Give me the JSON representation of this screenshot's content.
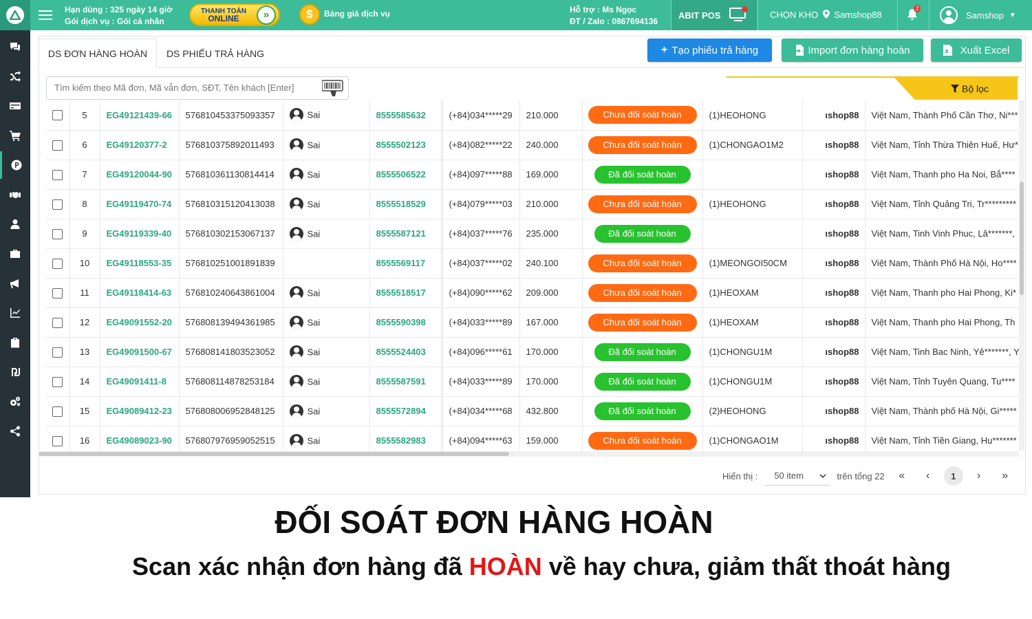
{
  "header": {
    "subscription_remaining": "Hạn dùng : 325 ngày 14 giờ",
    "subscription_plan": "Gói dịch vụ : Gói cá nhân",
    "pay_online_line1": "THANH TOÁN",
    "pay_online_line2": "ONLINE",
    "price_list_link": "Bảng giá dịch vụ",
    "support_contact": "Hỗ trợ : Ms Ngọc",
    "support_phone": "ĐT / Zalo : 0867694136",
    "abit_pos_label": "ABIT POS",
    "warehouse_label": "CHỌN KHO",
    "warehouse_name": "Samshop88",
    "notification_count": "2",
    "user_name": "Samshop"
  },
  "sidebar": {
    "items": [
      {
        "icon": "chat-icon"
      },
      {
        "icon": "shuffle-icon"
      },
      {
        "icon": "card-icon"
      },
      {
        "icon": "cart-icon"
      },
      {
        "icon": "p-icon",
        "active": true
      },
      {
        "icon": "handshake-icon"
      },
      {
        "icon": "user-icon"
      },
      {
        "icon": "briefcase-icon"
      },
      {
        "icon": "megaphone-icon"
      },
      {
        "icon": "chart-icon"
      },
      {
        "icon": "clipboard-icon"
      },
      {
        "icon": "currency-icon"
      },
      {
        "icon": "cogs-icon"
      },
      {
        "icon": "share-icon"
      }
    ]
  },
  "tabs": [
    {
      "label": "DS ĐƠN HÀNG HOÀN",
      "active": true
    },
    {
      "label": "DS PHIẾU TRẢ HÀNG",
      "active": false
    }
  ],
  "actions": {
    "create_return": "Tạo phiếu trả hàng",
    "import_returns": "Import đơn hàng hoàn",
    "export_excel": "Xuất Excel"
  },
  "search": {
    "placeholder": "Tìm kiếm theo Mã đơn, Mã vẫn đơn, SĐT, Tên khách [Enter]",
    "value": ""
  },
  "filter_label": "Bộ lọc",
  "colors": {
    "brand_green": "#3cbc98",
    "link_green": "#2da77e",
    "status_pending": "#ff6a13",
    "status_done": "#27c22e",
    "filter_yellow": "#f5c518",
    "create_blue": "#1e88e5"
  },
  "rows": [
    {
      "stt": "5",
      "code": "EG49121439-66",
      "tracking": "576810453375093357",
      "user": "Sai",
      "bill": "8555585632",
      "phone": "(+84)034*****29",
      "amount": "210.000",
      "status": "Chưa đối soát hoàn",
      "status_type": "pending",
      "item": "(1)HEOHONG",
      "shop": "ıshop88",
      "address": "Việt Nam, Thành Phố Cần Thơ, Ni***"
    },
    {
      "stt": "6",
      "code": "EG49120377-2",
      "tracking": "576810375892011493",
      "user": "Sai",
      "bill": "8555502123",
      "phone": "(+84)082*****22",
      "amount": "240.000",
      "status": "Chưa đối soát hoàn",
      "status_type": "pending",
      "item": "(1)CHONGAO1M2",
      "shop": "ıshop88",
      "address": "Việt Nam, Tỉnh Thừa Thiên Huế, Hư*"
    },
    {
      "stt": "7",
      "code": "EG49120044-90",
      "tracking": "576810361130814414",
      "user": "Sai",
      "bill": "8555506522",
      "phone": "(+84)097*****88",
      "amount": "169.000",
      "status": "Đã đối soát hoàn",
      "status_type": "done",
      "item": "",
      "shop": "ıshop88",
      "address": "Việt Nam, Thanh pho Ha Noi, Bắ****"
    },
    {
      "stt": "8",
      "code": "EG49119470-74",
      "tracking": "576810315120413038",
      "user": "Sai",
      "bill": "8555518529",
      "phone": "(+84)079*****03",
      "amount": "210.000",
      "status": "Chưa đối soát hoàn",
      "status_type": "pending",
      "item": "(1)HEOHONG",
      "shop": "ıshop88",
      "address": "Việt Nam, Tỉnh Quảng Tri, Tr*********"
    },
    {
      "stt": "9",
      "code": "EG49119339-40",
      "tracking": "576810302153067137",
      "user": "Sai",
      "bill": "8555587121",
      "phone": "(+84)037*****76",
      "amount": "235.000",
      "status": "Đã đối soát hoàn",
      "status_type": "done",
      "item": "",
      "shop": "ıshop88",
      "address": "Việt Nam, Tinh Vinh Phuc, Lâ*******,"
    },
    {
      "stt": "10",
      "code": "EG49118553-35",
      "tracking": "576810251001891839",
      "user": "",
      "bill": "8555569117",
      "phone": "(+84)037*****02",
      "amount": "240.100",
      "status": "Chưa đối soát hoàn",
      "status_type": "pending",
      "item": "(1)MEONGOI50CM",
      "shop": "ıshop88",
      "address": "Việt Nam, Thành Phố Hà Nội, Ho****"
    },
    {
      "stt": "11",
      "code": "EG49118414-63",
      "tracking": "576810240643861004",
      "user": "Sai",
      "bill": "8555518517",
      "phone": "(+84)090*****62",
      "amount": "209.000",
      "status": "Chưa đối soát hoàn",
      "status_type": "pending",
      "item": "(1)HEOXAM",
      "shop": "ıshop88",
      "address": "Việt Nam, Thanh pho Hai Phong, Ki*"
    },
    {
      "stt": "12",
      "code": "EG49091552-20",
      "tracking": "576808139494361985",
      "user": "Sai",
      "bill": "8555590398",
      "phone": "(+84)033*****89",
      "amount": "167.000",
      "status": "Chưa đối soát hoàn",
      "status_type": "pending",
      "item": "(1)HEOXAM",
      "shop": "ıshop88",
      "address": "Việt Nam, Thanh pho Hai Phong, Th"
    },
    {
      "stt": "13",
      "code": "EG49091500-67",
      "tracking": "576808141803523052",
      "user": "Sai",
      "bill": "8555524403",
      "phone": "(+84)096*****61",
      "amount": "170.000",
      "status": "Đã đối soát hoàn",
      "status_type": "done",
      "item": "(1)CHONGU1M",
      "shop": "ıshop88",
      "address": "Việt Nam, Tinh Bac Ninh, Yê*******, Y"
    },
    {
      "stt": "14",
      "code": "EG49091411-8",
      "tracking": "576808114878253184",
      "user": "Sai",
      "bill": "8555587591",
      "phone": "(+84)033*****89",
      "amount": "170.000",
      "status": "Đã đối soát hoàn",
      "status_type": "done",
      "item": "(1)CHONGU1M",
      "shop": "ıshop88",
      "address": "Việt Nam, Tỉnh Tuyên Quang, Tu****"
    },
    {
      "stt": "15",
      "code": "EG49089412-23",
      "tracking": "576808006952848125",
      "user": "Sai",
      "bill": "8555572894",
      "phone": "(+84)034*****68",
      "amount": "432.800",
      "status": "Đã đối soát hoàn",
      "status_type": "done",
      "item": "(2)HEOHONG",
      "shop": "ıshop88",
      "address": "Việt Nam, Thành phố Hà Nội, Gi*****"
    },
    {
      "stt": "16",
      "code": "EG49089023-90",
      "tracking": "576807976959052515",
      "user": "Sai",
      "bill": "8555582983",
      "phone": "(+84)094*****63",
      "amount": "159.000",
      "status": "Chưa đối soát hoàn",
      "status_type": "pending",
      "item": "(1)CHONGAO1M",
      "shop": "ıshop88",
      "address": "Việt Nam, Tỉnh Tiền Giang, Hu*******"
    }
  ],
  "pagination": {
    "display_label": "Hiển thị :",
    "per_page": "50 item",
    "total_label": "trên tổng 22",
    "current_page": "1"
  },
  "caption": {
    "title": "ĐỐI SOÁT ĐƠN HÀNG HOÀN",
    "subtitle_before": "Scan xác nhận đơn hàng đã",
    "subtitle_highlight": "HOÀN",
    "subtitle_after": "về hay chưa, giảm thất thoát hàng"
  }
}
